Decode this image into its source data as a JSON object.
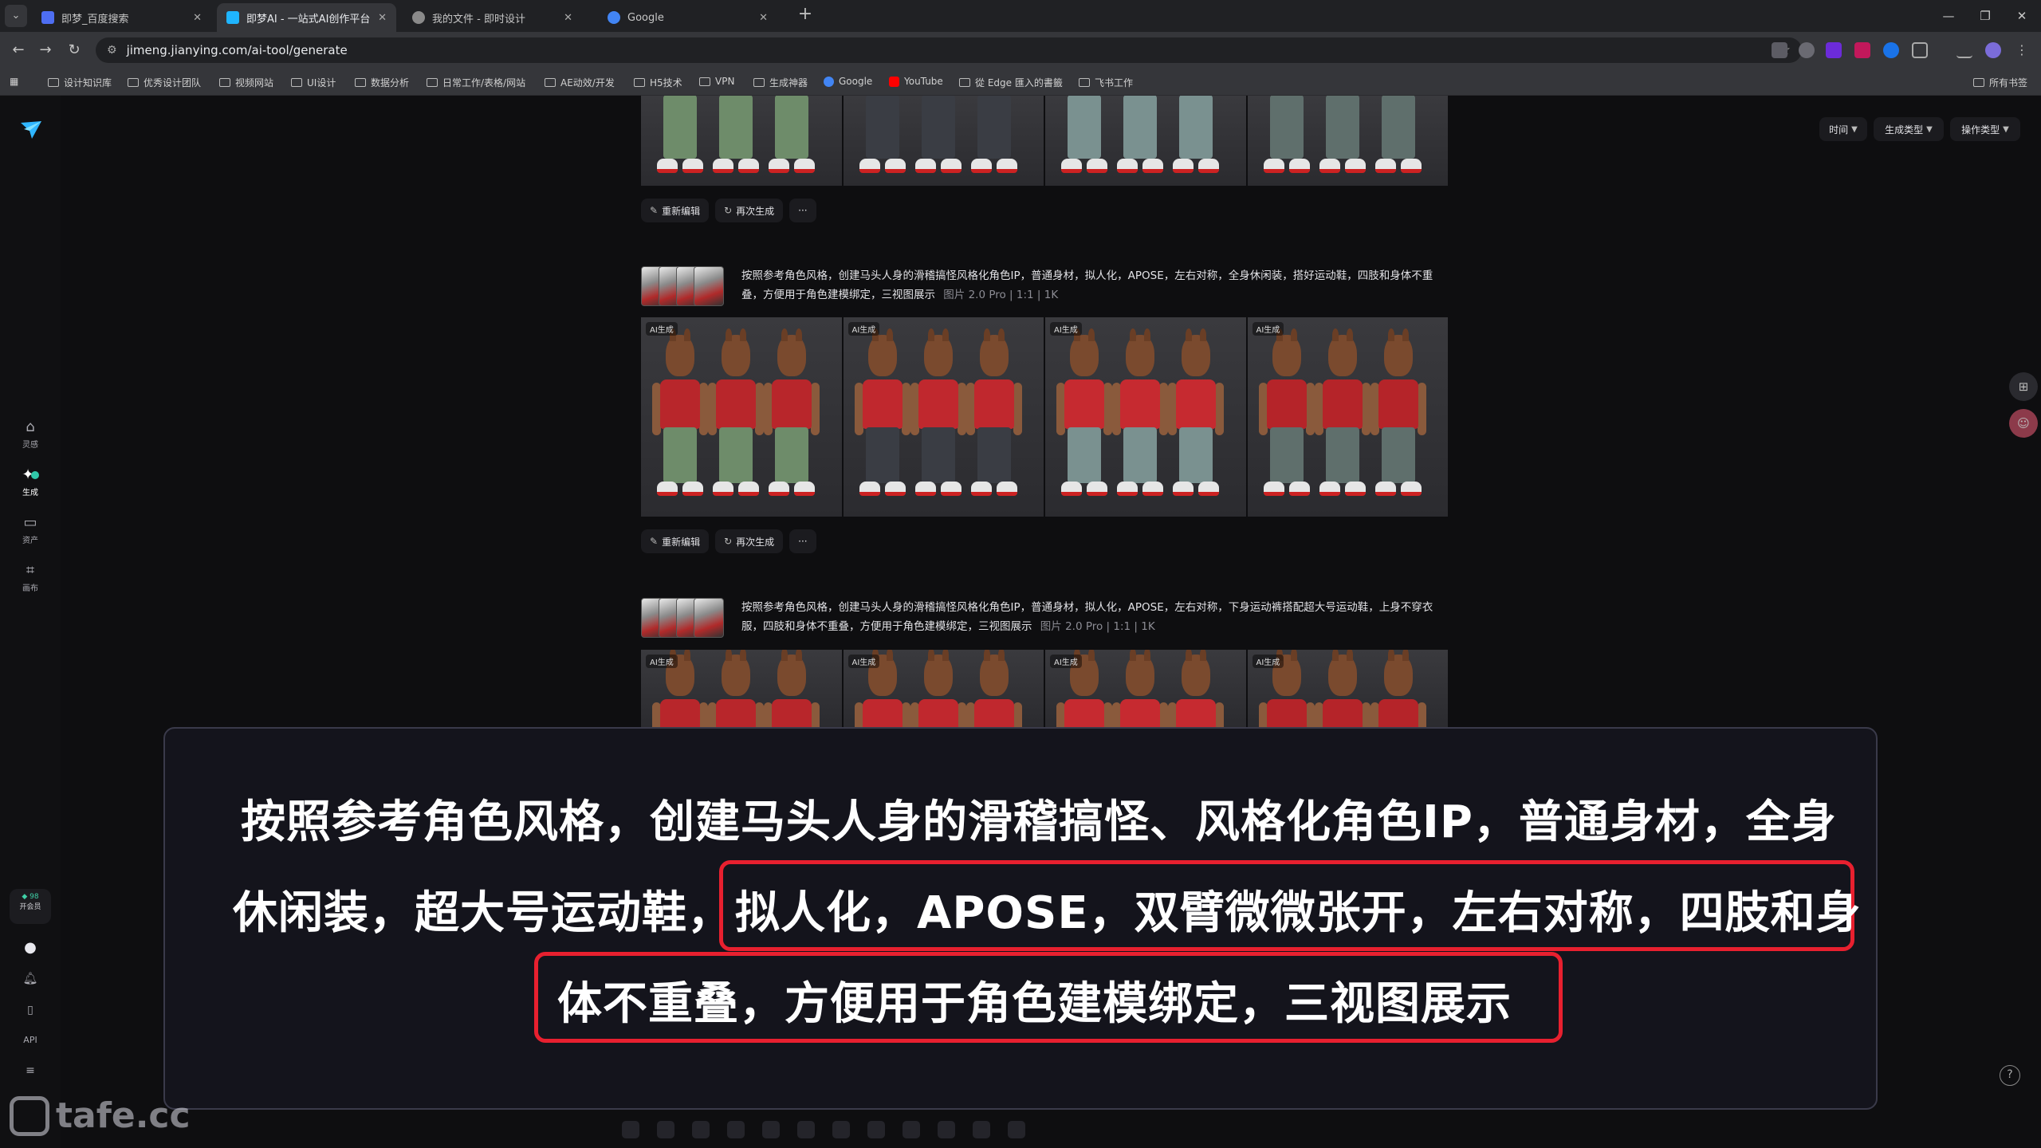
{
  "browser": {
    "tabs": [
      {
        "title": "即梦_百度搜索",
        "favicon_color": "#4e6ef2"
      },
      {
        "title": "即梦AI - 一站式AI创作平台",
        "favicon_color": "#1fb5ff"
      },
      {
        "title": "我的文件 - 即时设计",
        "favicon_color": "#8a8a8a"
      },
      {
        "title": "Google",
        "favicon_color": "#4285f4"
      }
    ],
    "url": "jimeng.jianying.com/ai-tool/generate",
    "bookmarks": [
      "设计知识库",
      "优秀设计团队",
      "视频网站",
      "UI设计",
      "数据分析",
      "日常工作/表格/网站",
      "AE动效/开发",
      "H5技术",
      "VPN",
      "生成神器",
      "Google",
      "YouTube",
      "從 Edge 匯入的書籤",
      "飞书工作"
    ],
    "all_bookmarks": "所有书签"
  },
  "sidebar": {
    "items": [
      {
        "label": "灵感",
        "icon": "home-icon"
      },
      {
        "label": "生成",
        "icon": "generate-icon"
      },
      {
        "label": "资产",
        "icon": "folder-icon"
      },
      {
        "label": "画布",
        "icon": "canvas-icon"
      }
    ],
    "credits_value": "98",
    "credits_label": "开会员",
    "api_label": "API"
  },
  "filters": [
    {
      "label": "时间"
    },
    {
      "label": "生成类型"
    },
    {
      "label": "操作类型"
    }
  ],
  "actions": {
    "reedit": "重新编辑",
    "regenerate": "再次生成",
    "more": "···"
  },
  "feed": [
    {
      "prompt": "按照参考角色风格，创建马头人身的滑稽搞怪风格化角色IP，普通身材，拟人化，APOSE，左右对称，全身休闲装，搭好运动鞋，四肢和身体不重叠，方便用于角色建模绑定，三视图展示",
      "meta": [
        "图片 2.0 Pro",
        "1:1",
        "1K"
      ],
      "tags": [
        "AI生成",
        "AI生成",
        "AI生成",
        "AI生成"
      ]
    },
    {
      "prompt": "按照参考角色风格，创建马头人身的滑稽搞怪风格化角色IP，普通身材，拟人化，APOSE，左右对称，下身运动裤搭配超大号运动鞋，上身不穿衣服，四肢和身体不重叠，方便用于角色建模绑定，三视图展示",
      "meta": [
        "图片 2.0 Pro",
        "1:1",
        "1K"
      ],
      "tags": [
        "AI生成",
        "AI生成",
        "AI生成",
        "AI生成"
      ]
    }
  ],
  "caption": {
    "line1": "按照参考角色风格，创建马头人身的滑稽搞怪、风格化角色IP，普通身材，全身",
    "line2a": "休闲装，超大号运动鞋，",
    "line2b": "拟人化，APOSE，双臂微微张开，左右对称，四肢和身",
    "line3": "体不重叠，方便用于角色建模绑定，三视图展示",
    "highlight_color": "#e8202f"
  },
  "watermark": "tafe.cc"
}
